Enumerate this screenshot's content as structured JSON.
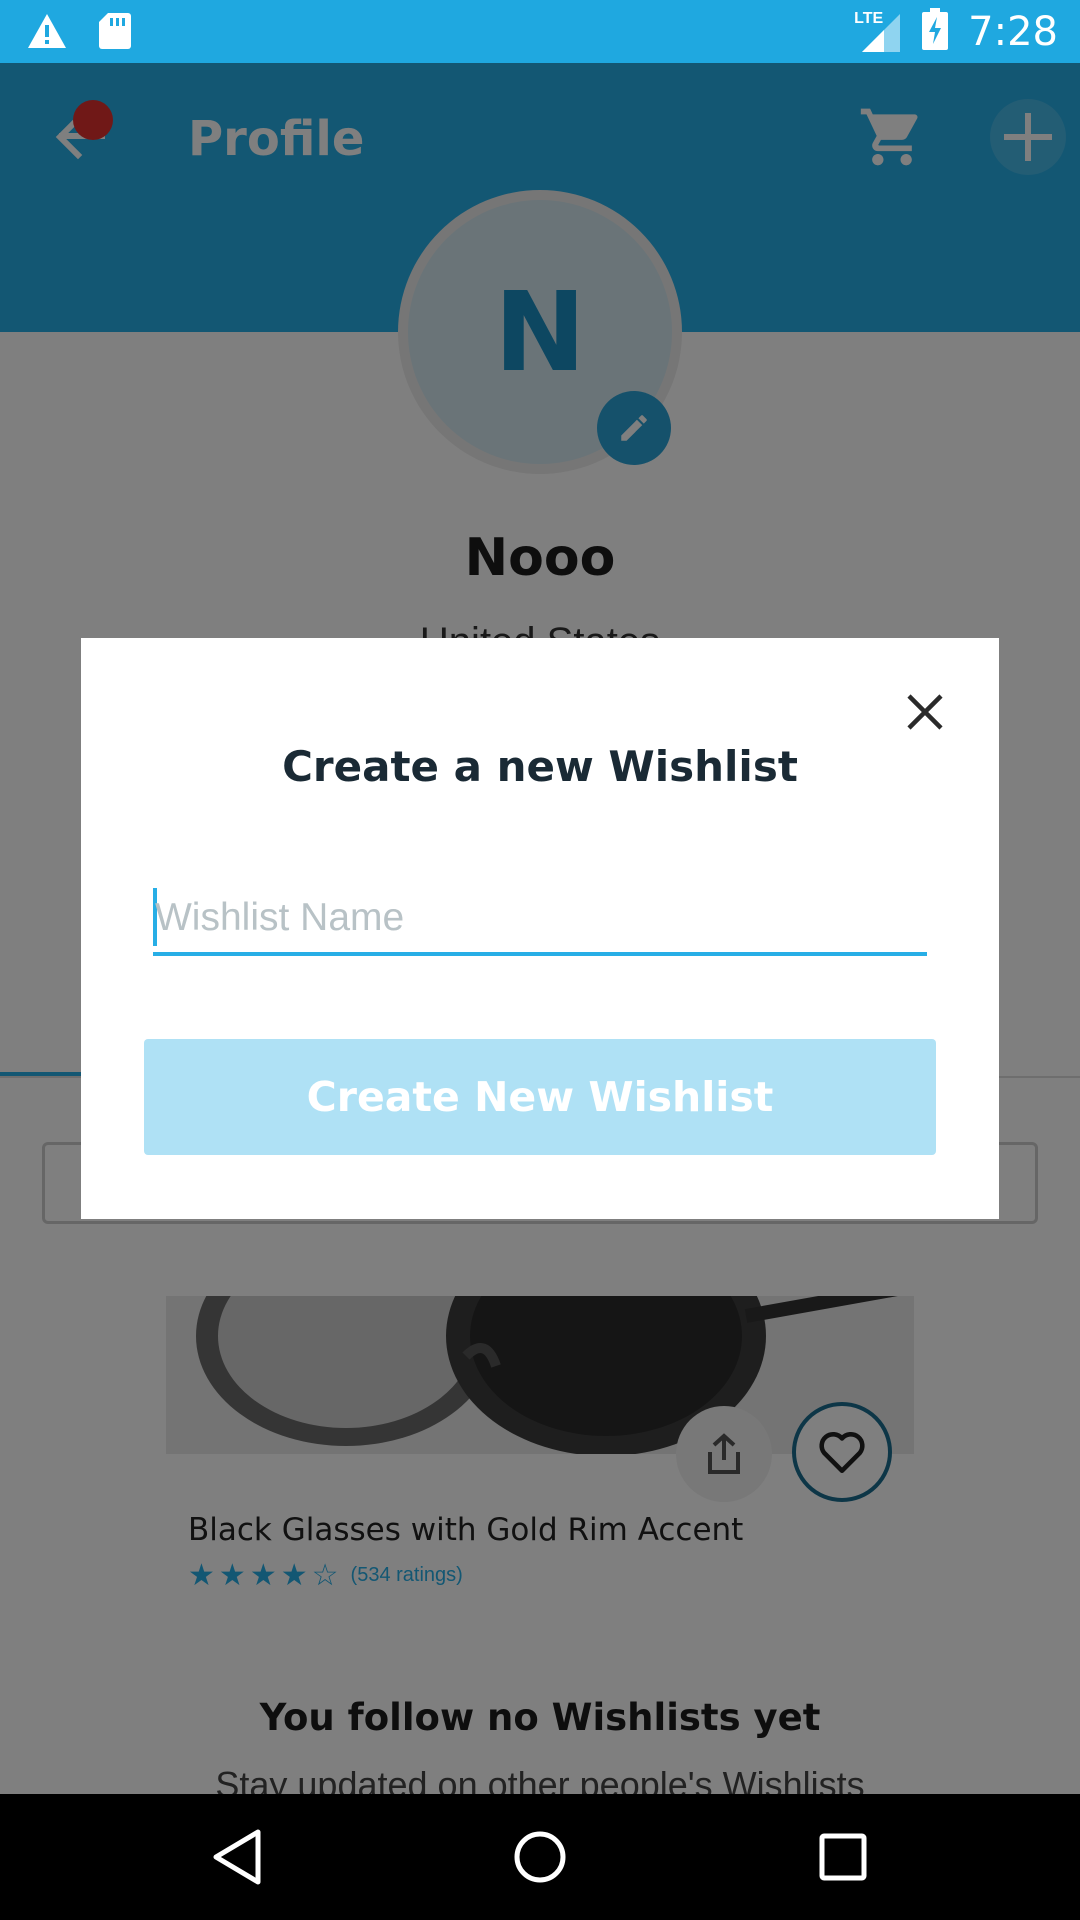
{
  "status_bar": {
    "time": "7:28",
    "network": "LTE",
    "icons": [
      "warning-icon",
      "sd-card-icon",
      "signal-icon",
      "battery-charging-icon"
    ]
  },
  "app_bar": {
    "title": "Profile",
    "icons": [
      "back-arrow-icon",
      "cart-icon",
      "plus-icon"
    ]
  },
  "profile": {
    "avatar_letter": "N",
    "name": "Nooo",
    "country": "United States"
  },
  "product": {
    "title": "Black Glasses with Gold Rim Accent",
    "rating": 4,
    "rating_count": "(534 ratings)"
  },
  "empty_state": {
    "title": "You follow no Wishlists yet",
    "subtitle": "Stay updated on other people's Wishlists"
  },
  "modal": {
    "title": "Create a new Wishlist",
    "input_value": "",
    "input_placeholder": "Wishlist Name",
    "button_label": "Create New Wishlist"
  },
  "colors": {
    "primary": "#27aee6",
    "status_bar": "#1fa8e0",
    "button_disabled": "#afe1f5"
  }
}
